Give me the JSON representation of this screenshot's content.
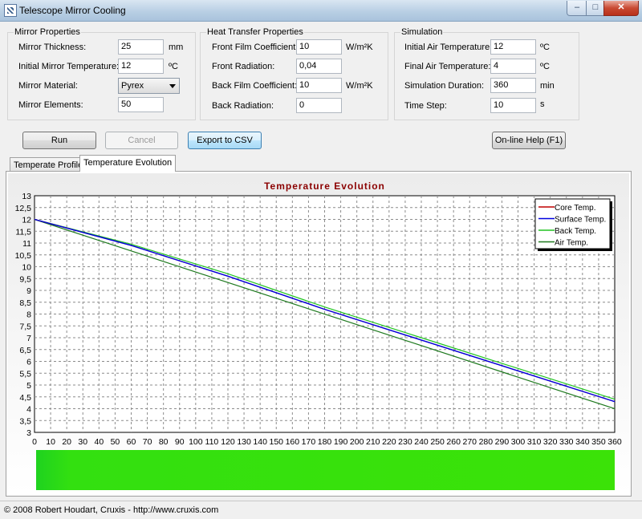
{
  "window": {
    "title": "Telescope Mirror Cooling",
    "min": "–",
    "max": "□",
    "close": "✕"
  },
  "mirror": {
    "title": "Mirror Properties",
    "thickness_label": "Mirror Thickness:",
    "thickness": "25",
    "thickness_unit": "mm",
    "init_temp_label": "Initial Mirror Temperature:",
    "init_temp": "12",
    "init_temp_unit": "ºC",
    "material_label": "Mirror Material:",
    "material": "Pyrex",
    "elements_label": "Mirror Elements:",
    "elements": "50"
  },
  "heat": {
    "title": "Heat Transfer Properties",
    "front_film_label": "Front Film Coefficient:",
    "front_film": "10",
    "front_film_unit": "W/m²K",
    "front_rad_label": "Front Radiation:",
    "front_rad": "0,04",
    "back_film_label": "Back Film Coefficient:",
    "back_film": "10",
    "back_film_unit": "W/m²K",
    "back_rad_label": "Back Radiation:",
    "back_rad": "0"
  },
  "sim": {
    "title": "Simulation",
    "init_air_label": "Initial Air Temperature:",
    "init_air": "12",
    "init_air_unit": "ºC",
    "final_air_label": "Final Air Temperature:",
    "final_air": "4",
    "final_air_unit": "ºC",
    "duration_label": "Simulation Duration:",
    "duration": "360",
    "duration_unit": "min",
    "step_label": "Time Step:",
    "step": "10",
    "step_unit": "s"
  },
  "buttons": {
    "run": "Run",
    "cancel": "Cancel",
    "export": "Export to CSV",
    "help": "On-line Help (F1)"
  },
  "tabs": {
    "profile": "Temperate Profile",
    "evolution": "Temperature Evolution"
  },
  "status": "© 2008 Robert Houdart, Cruxis  -  http://www.cruxis.com",
  "colors": {
    "core": "#c00000",
    "surface": "#0000e0",
    "back": "#22c422",
    "air": "#1f7a1f",
    "title": "#8b0000",
    "bar": "#2fdc10"
  },
  "chart_data": {
    "type": "line",
    "title": "Temperature Evolution",
    "xlim": [
      0,
      360
    ],
    "ylim": [
      3,
      13
    ],
    "xticks": [
      0,
      10,
      20,
      30,
      40,
      50,
      60,
      70,
      80,
      90,
      100,
      110,
      120,
      130,
      140,
      150,
      160,
      170,
      180,
      190,
      200,
      210,
      220,
      230,
      240,
      250,
      260,
      270,
      280,
      290,
      300,
      310,
      320,
      330,
      340,
      350,
      360
    ],
    "yticks": [
      3,
      3.5,
      4,
      4.5,
      5,
      5.5,
      6,
      6.5,
      7,
      7.5,
      8,
      8.5,
      9,
      9.5,
      10,
      10.5,
      11,
      11.5,
      12,
      12.5,
      13
    ],
    "ytick_labels": [
      "3",
      "3,5",
      "4",
      "4,5",
      "5",
      "5,5",
      "6",
      "6,5",
      "7",
      "7,5",
      "8",
      "8,5",
      "9",
      "9,5",
      "10",
      "10,5",
      "11",
      "11,5",
      "12",
      "12,5",
      "13"
    ],
    "grid": true,
    "legend_position": "top-right",
    "series": [
      {
        "name": "Core Temp.",
        "x": [
          0,
          60,
          120,
          180,
          240,
          300,
          360
        ],
        "y": [
          12,
          10.9,
          9.6,
          8.2,
          6.9,
          5.6,
          4.3
        ]
      },
      {
        "name": "Surface Temp.",
        "x": [
          0,
          60,
          120,
          180,
          240,
          300,
          360
        ],
        "y": [
          12,
          10.9,
          9.6,
          8.2,
          6.9,
          5.6,
          4.3
        ]
      },
      {
        "name": "Back Temp.",
        "x": [
          0,
          60,
          120,
          180,
          240,
          300,
          360
        ],
        "y": [
          12,
          10.95,
          9.7,
          8.3,
          7.0,
          5.7,
          4.4
        ]
      },
      {
        "name": "Air Temp.",
        "x": [
          0,
          360
        ],
        "y": [
          12,
          4
        ]
      }
    ]
  }
}
